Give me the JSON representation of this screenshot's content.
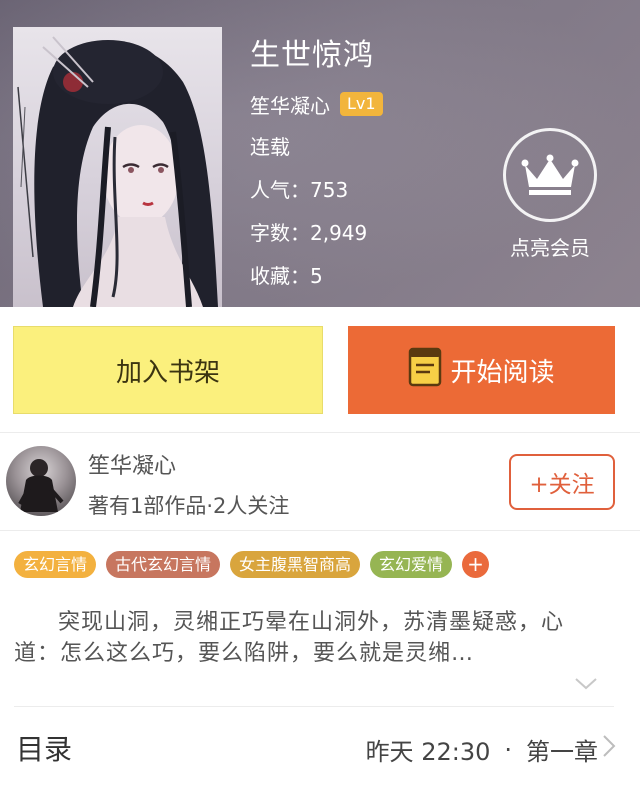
{
  "book": {
    "title": "生世惊鸿",
    "author": "笙华凝心",
    "level": "Lv1",
    "status": "连载",
    "popularity_label": "人气：",
    "popularity": "753",
    "words_label": "字数：",
    "words": "2,949",
    "favorites_label": "收藏：",
    "favorites": "5"
  },
  "vip": {
    "label": "点亮会员",
    "icon": "crown-icon"
  },
  "actions": {
    "add_shelf": "加入书架",
    "start_reading": "开始阅读",
    "reading_icon": "book-icon"
  },
  "author_card": {
    "name": "笙华凝心",
    "meta": "著有1部作品·2人关注",
    "follow": "+关注"
  },
  "tags": [
    {
      "label": "玄幻言情",
      "color": "#f3b13f"
    },
    {
      "label": "古代玄幻言情",
      "color": "#c7765f"
    },
    {
      "label": "女主腹黑智商高",
      "color": "#d9a53d"
    },
    {
      "label": "玄幻爱情",
      "color": "#96b553"
    }
  ],
  "tags_more": "+",
  "description": "突现山洞，灵缃正巧晕在山洞外，苏清墨疑惑，心道：怎么这么巧，要么陷阱，要么就是灵缃…",
  "toc": {
    "title": "目录",
    "updated": "昨天 22:30",
    "separator": "·",
    "latest_chapter": "第一章"
  },
  "colors": {
    "accent": "#ec6a36",
    "shelf_button": "#fbf07d",
    "level_badge": "#f2b53c"
  }
}
